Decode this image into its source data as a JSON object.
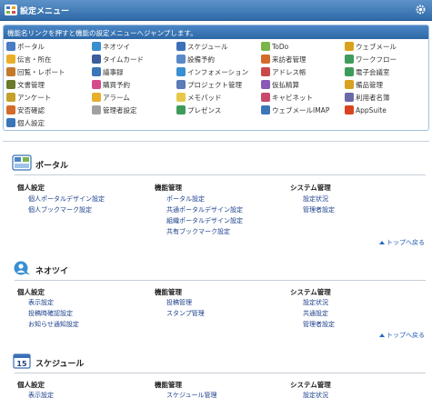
{
  "header": {
    "title": "設定メニュー"
  },
  "menu_panel": {
    "description": "機能名リンクを押すと機能の設定メニューへジャンプします。",
    "items": [
      {
        "label": "ポータル",
        "icon": "portal-icon",
        "color": "#4a7bc4"
      },
      {
        "label": "ネオツイ",
        "icon": "neotwi-icon",
        "color": "#3a8fd0"
      },
      {
        "label": "スケジュール",
        "icon": "schedule-icon",
        "color": "#3c6fb8"
      },
      {
        "label": "ToDo",
        "icon": "todo-icon",
        "color": "#7ab648"
      },
      {
        "label": "ウェブメール",
        "icon": "webmail-icon",
        "color": "#d9a21e"
      },
      {
        "label": "伝言・所在",
        "icon": "message-icon",
        "color": "#e8b02a"
      },
      {
        "label": "タイムカード",
        "icon": "timecard-icon",
        "color": "#3a5f9c"
      },
      {
        "label": "設備予約",
        "icon": "facility-icon",
        "color": "#5a89c8"
      },
      {
        "label": "来訪者管理",
        "icon": "visitor-icon",
        "color": "#d46a2a"
      },
      {
        "label": "ワークフロー",
        "icon": "workflow-icon",
        "color": "#3f9b5c"
      },
      {
        "label": "回覧・レポート",
        "icon": "circular-icon",
        "color": "#c47a2a"
      },
      {
        "label": "議事録",
        "icon": "minutes-icon",
        "color": "#3a76b8"
      },
      {
        "label": "インフォメーション",
        "icon": "information-icon",
        "color": "#3a8fd0"
      },
      {
        "label": "アドレス帳",
        "icon": "address-book-icon",
        "color": "#c84a4a"
      },
      {
        "label": "電子会議室",
        "icon": "e-conference-icon",
        "color": "#3f9b5c"
      },
      {
        "label": "文書管理",
        "icon": "document-icon",
        "color": "#6a7a2a"
      },
      {
        "label": "購買予約",
        "icon": "purchase-icon",
        "color": "#d44a8a"
      },
      {
        "label": "プロジェクト管理",
        "icon": "project-icon",
        "color": "#5a7ab8"
      },
      {
        "label": "仮払精算",
        "icon": "expense-icon",
        "color": "#8a5ab8"
      },
      {
        "label": "備品管理",
        "icon": "equipment-icon",
        "color": "#d9a21e"
      },
      {
        "label": "アンケート",
        "icon": "survey-icon",
        "color": "#c4a22a"
      },
      {
        "label": "アラーム",
        "icon": "alarm-icon",
        "color": "#e8b02a"
      },
      {
        "label": "メモパッド",
        "icon": "memopad-icon",
        "color": "#e8c84a"
      },
      {
        "label": "キャビネット",
        "icon": "cabinet-icon",
        "color": "#c84a6a"
      },
      {
        "label": "利用者名簿",
        "icon": "user-list-icon",
        "color": "#6a6aa8"
      },
      {
        "label": "安否確認",
        "icon": "safety-icon",
        "color": "#d46a2a"
      },
      {
        "label": "管理者設定",
        "icon": "admin-settings-icon",
        "color": "#a0a0a0"
      },
      {
        "label": "プレゼンス",
        "icon": "presence-icon",
        "color": "#3f9b5c"
      },
      {
        "label": "ウェブメールIMAP",
        "icon": "webmail-imap-icon",
        "color": "#3a76b8"
      },
      {
        "label": "AppSuite",
        "icon": "appsuite-icon",
        "color": "#d9441e"
      },
      {
        "label": "個人設定",
        "icon": "personal-settings-icon",
        "color": "#3a76b8"
      }
    ]
  },
  "sections": [
    {
      "title": "ポータル",
      "icon": "portal-section-icon",
      "columns": [
        {
          "heading": "個人設定",
          "links": [
            "個人ポータルデザイン設定",
            "個人ブックマーク設定"
          ]
        },
        {
          "heading": "機能管理",
          "links": [
            "ポータル設定",
            "共通ポータルデザイン設定",
            "組織ポータルデザイン設定",
            "共有ブックマーク設定"
          ]
        },
        {
          "heading": "システム管理",
          "links": [
            "設定状況",
            "管理者設定"
          ]
        }
      ],
      "to_top": "トップへ戻る"
    },
    {
      "title": "ネオツイ",
      "icon": "neotwi-section-icon",
      "columns": [
        {
          "heading": "個人設定",
          "links": [
            "表示設定",
            "投稿時確認設定",
            "お知らせ通知設定"
          ]
        },
        {
          "heading": "機能管理",
          "links": [
            "投稿管理",
            "スタンプ管理"
          ]
        },
        {
          "heading": "システム管理",
          "links": [
            "設定状況",
            "共通設定",
            "管理者設定"
          ]
        }
      ],
      "to_top": "トップへ戻る"
    },
    {
      "title": "スケジュール",
      "icon": "schedule-section-icon",
      "icon_text": "15",
      "columns": [
        {
          "heading": "個人設定",
          "links": [
            "表示設定"
          ]
        },
        {
          "heading": "機能管理",
          "links": [
            "スケジュール管理"
          ]
        },
        {
          "heading": "システム管理",
          "links": [
            "設定状況"
          ]
        }
      ]
    }
  ]
}
